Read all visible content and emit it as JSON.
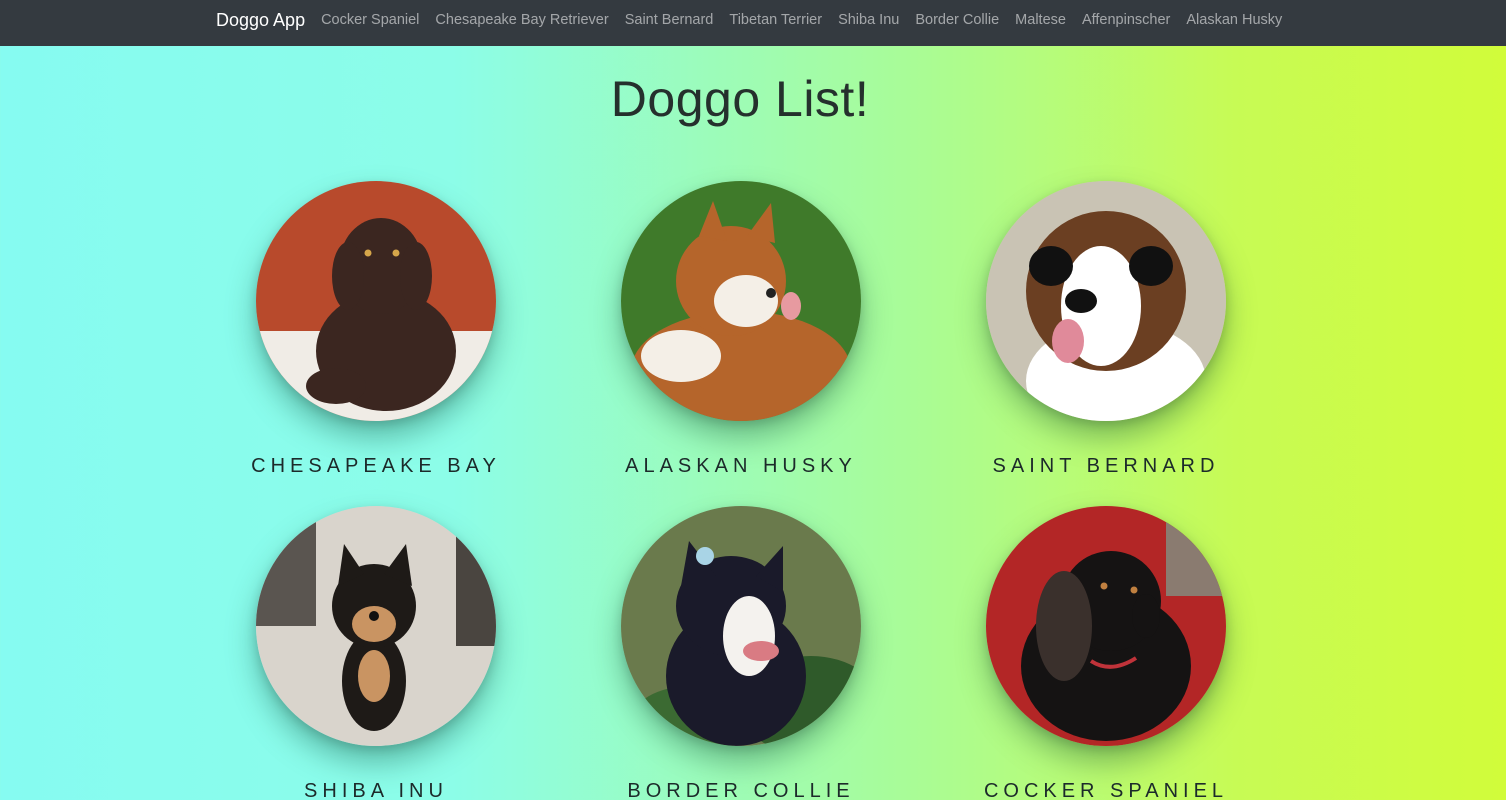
{
  "navbar": {
    "brand": "Doggo App",
    "links": [
      "Cocker Spaniel",
      "Chesapeake Bay Retriever",
      "Saint Bernard",
      "Tibetan Terrier",
      "Shiba Inu",
      "Border Collie",
      "Maltese",
      "Affenpinscher",
      "Alaskan Husky"
    ]
  },
  "page": {
    "title": "Doggo List!"
  },
  "dogs": [
    {
      "name": "CHESAPEAKE BAY",
      "colors": {
        "bg": "#b84a2c",
        "fur": "#3b2620",
        "accent": "#f0ece6"
      }
    },
    {
      "name": "ALASKAN HUSKY",
      "colors": {
        "bg": "#3f7a2a",
        "fur": "#b5652b",
        "accent": "#f4efe7"
      }
    },
    {
      "name": "SAINT BERNARD",
      "colors": {
        "bg": "#c9c3b4",
        "fur": "#6b3f22",
        "accent": "#ffffff"
      }
    },
    {
      "name": "SHIBA INU",
      "colors": {
        "bg": "#d9d4cc",
        "fur": "#1e1a17",
        "accent": "#c99462"
      }
    },
    {
      "name": "BORDER COLLIE",
      "colors": {
        "bg": "#6a7a4c",
        "fur": "#1a1a2a",
        "accent": "#f4f2ee"
      }
    },
    {
      "name": "COCKER SPANIEL",
      "colors": {
        "bg": "#b32626",
        "fur": "#151313",
        "accent": "#3a302c"
      }
    }
  ]
}
